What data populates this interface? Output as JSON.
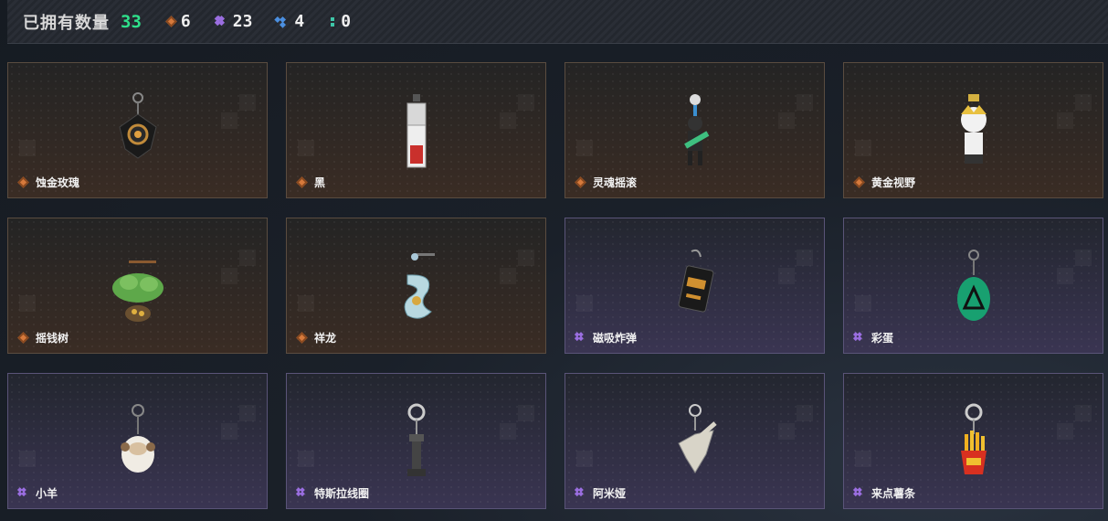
{
  "header": {
    "owned_label": "已拥有数量",
    "owned_count": "33",
    "stats": [
      {
        "icon": "orange-diamond-icon",
        "value": "6",
        "color": "#d77a3c"
      },
      {
        "icon": "purple-diamond-cluster-icon",
        "value": "23",
        "color": "#9a6ee0"
      },
      {
        "icon": "blue-diamond-cluster-icon",
        "value": "4",
        "color": "#4b8fe0"
      },
      {
        "icon": "teal-dots-icon",
        "value": "0",
        "color": "#3ec6a8"
      }
    ]
  },
  "items": [
    {
      "name": "蚀金玫瑰",
      "rarity": "orange",
      "art": "rose-charm"
    },
    {
      "name": "黑",
      "rarity": "orange",
      "art": "card-charm"
    },
    {
      "name": "灵魂摇滚",
      "rarity": "orange",
      "art": "guitarist-charm"
    },
    {
      "name": "黄金视野",
      "rarity": "orange",
      "art": "doll-charm"
    },
    {
      "name": "摇钱树",
      "rarity": "orange",
      "art": "money-tree-charm"
    },
    {
      "name": "祥龙",
      "rarity": "orange",
      "art": "dragon-charm"
    },
    {
      "name": "磁吸炸弹",
      "rarity": "purple",
      "art": "bomb-charm"
    },
    {
      "name": "彩蛋",
      "rarity": "purple",
      "art": "egg-charm"
    },
    {
      "name": "小羊",
      "rarity": "purple",
      "art": "sheep-charm"
    },
    {
      "name": "特斯拉线圈",
      "rarity": "purple",
      "art": "tesla-coil-charm"
    },
    {
      "name": "阿米娅",
      "rarity": "purple",
      "art": "bunny-charm"
    },
    {
      "name": "来点薯条",
      "rarity": "purple",
      "art": "fries-charm"
    }
  ]
}
